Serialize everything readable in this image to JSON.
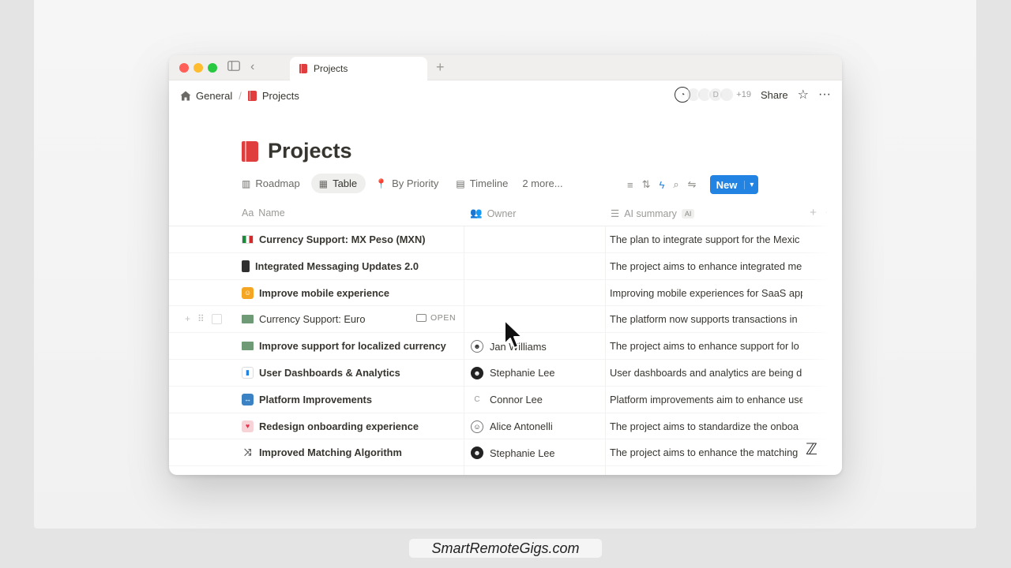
{
  "window": {
    "tab_title": "Projects"
  },
  "breadcrumb": {
    "items": [
      "General",
      "Projects"
    ]
  },
  "topbar": {
    "extra_collaborators": "+19",
    "share_label": "Share"
  },
  "page": {
    "title": "Projects"
  },
  "views": {
    "items": [
      "Roadmap",
      "Table",
      "By Priority",
      "Timeline",
      "2 more..."
    ],
    "active": "Table",
    "new_label": "New"
  },
  "table": {
    "columns": {
      "name": "Name",
      "owner": "Owner",
      "ai": "AI summary",
      "ai_badge": "AI",
      "name_prefix": "Aa"
    },
    "open_label": "OPEN",
    "rows": [
      {
        "name": "Currency Support: MX Peso (MXN)",
        "owner": "",
        "summary": "The plan to integrate support for the Mexic"
      },
      {
        "name": "Integrated Messaging Updates 2.0",
        "owner": "",
        "summary": "The project aims to enhance integrated me"
      },
      {
        "name": "Improve mobile experience",
        "owner": "",
        "summary": "Improving mobile experiences for SaaS app"
      },
      {
        "name": "Currency Support: Euro",
        "owner": "",
        "summary": "The platform now supports transactions in"
      },
      {
        "name": "Improve support for localized currency",
        "owner": "Jan    Williams",
        "summary": "The project aims to enhance support for lo"
      },
      {
        "name": "User Dashboards & Analytics",
        "owner": "Stephanie Lee",
        "summary": "User dashboards and analytics are being d"
      },
      {
        "name": "Platform Improvements",
        "owner": "Connor Lee",
        "summary": "Platform improvements aim to enhance use"
      },
      {
        "name": "Redesign onboarding experience",
        "owner": "Alice Antonelli",
        "summary": "The project aims to standardize the onboa"
      },
      {
        "name": "Improved Matching Algorithm",
        "owner": "Stephanie Lee",
        "summary": "The project aims to enhance the matching"
      }
    ]
  },
  "watermark": "SmartRemoteGigs.com",
  "colors": {
    "accent": "#2383e2",
    "book_red": "#e03e3e",
    "text": "#37352f"
  }
}
